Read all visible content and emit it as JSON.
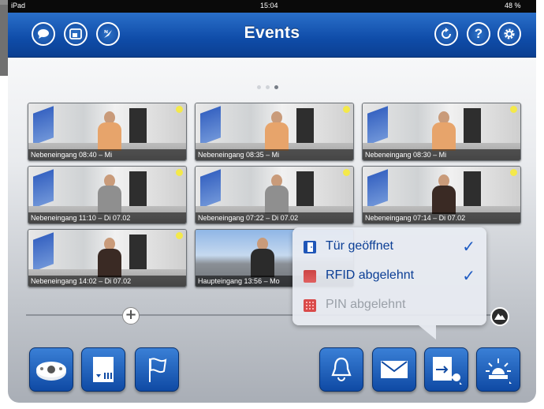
{
  "status": {
    "device": "iPad",
    "time": "15:04",
    "battery": "48 %"
  },
  "nav": {
    "title": "Events"
  },
  "page_dots": {
    "count": 3,
    "active": 2
  },
  "thumbnails": [
    {
      "caption": "Nebeneingang 08:40 – Mi"
    },
    {
      "caption": "Nebeneingang 08:35 – Mi"
    },
    {
      "caption": "Nebeneingang 08:30 – Mi"
    },
    {
      "caption": "Nebeneingang 11:10 – Di 07.02"
    },
    {
      "caption": "Nebeneingang 07:22 – Di 07.02"
    },
    {
      "caption": "Nebeneingang 07:14 – Di 07.02"
    },
    {
      "caption": "Nebeneingang 14:02 – Di 07.02"
    },
    {
      "caption": "Haupteingang 13:56 – Mo"
    }
  ],
  "filter_popup": {
    "items": [
      {
        "label": "Tür geöffnet",
        "checked": true,
        "enabled": true
      },
      {
        "label": "RFID abgelehnt",
        "checked": true,
        "enabled": true
      },
      {
        "label": "PIN abgelehnt",
        "checked": false,
        "enabled": false
      }
    ],
    "check_glyph": "✓"
  },
  "colors": {
    "nav_blue": "#0f4ca8",
    "accent_blue": "#1e5bc2",
    "marker_yellow": "#f4e94a"
  },
  "icons": [
    "chat-icon",
    "window-icon",
    "compass-icon",
    "refresh-icon",
    "help-icon",
    "gear-icon",
    "zoom-plus-icon",
    "mountain-icon",
    "camera-icon",
    "sd-card-icon",
    "flag-icon",
    "bell-icon",
    "mail-icon",
    "door-key-icon",
    "alarm-light-icon"
  ],
  "help_glyph": "?",
  "plus_glyph": "+"
}
